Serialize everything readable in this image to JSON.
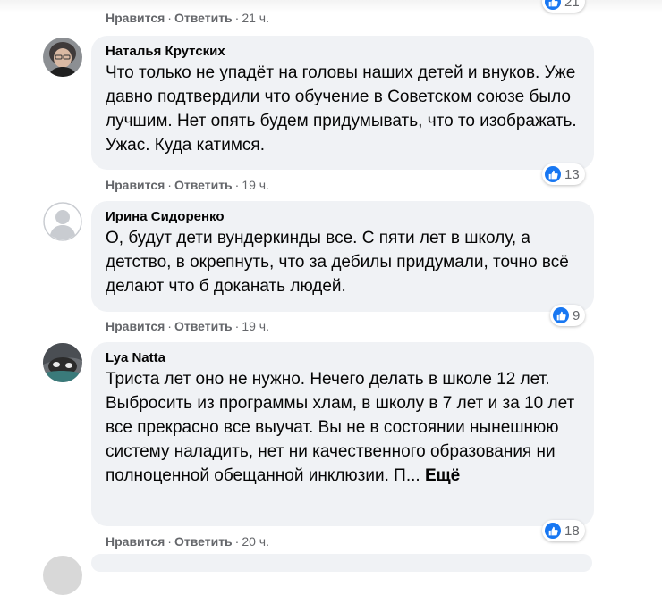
{
  "top_action_bar": {
    "like": "Нравится",
    "reply": "Ответить",
    "time": "21 ч.",
    "reactions": "21"
  },
  "comments": [
    {
      "author": "Наталья Крутских",
      "text": "Что только не упадёт на головы наших детей и внуков. Уже давно подтвердили что обучение в Советском союзе было лучшим. Нет опять будем придумывать, что то изображать. Ужас. Куда катимся.",
      "reactions": "13",
      "like": "Нравится",
      "reply": "Ответить",
      "time": "19 ч."
    },
    {
      "author": "Ирина Сидоренко",
      "text": "О, будут дети вундеркинды все. С пяти лет в школу, а детство, в окрепнуть, что за дебилы придумали, точно всё делают что б доканать людей.",
      "reactions": "9",
      "like": "Нравится",
      "reply": "Ответить",
      "time": "19 ч."
    },
    {
      "author": "Lya Natta",
      "text": "Триста лет оно не нужно. Нечего делать в школе 12 лет. Выбросить из программы хлам, в школу в 7 лет и за 10 лет все прекрасно все выучат. Вы не в состоянии нынешнюю систему наладить, нет ни качественного образования ни полноценной обещанной инклюзии. П...",
      "more": "Ещё",
      "reactions": "18",
      "like": "Нравится",
      "reply": "Ответить",
      "time": "20 ч."
    }
  ],
  "colors": {
    "bubble": "#f0f2f5",
    "meta_text": "#65676b",
    "like_blue": "#1877f2"
  },
  "icons": [
    "like-icon",
    "default-avatar-icon"
  ]
}
